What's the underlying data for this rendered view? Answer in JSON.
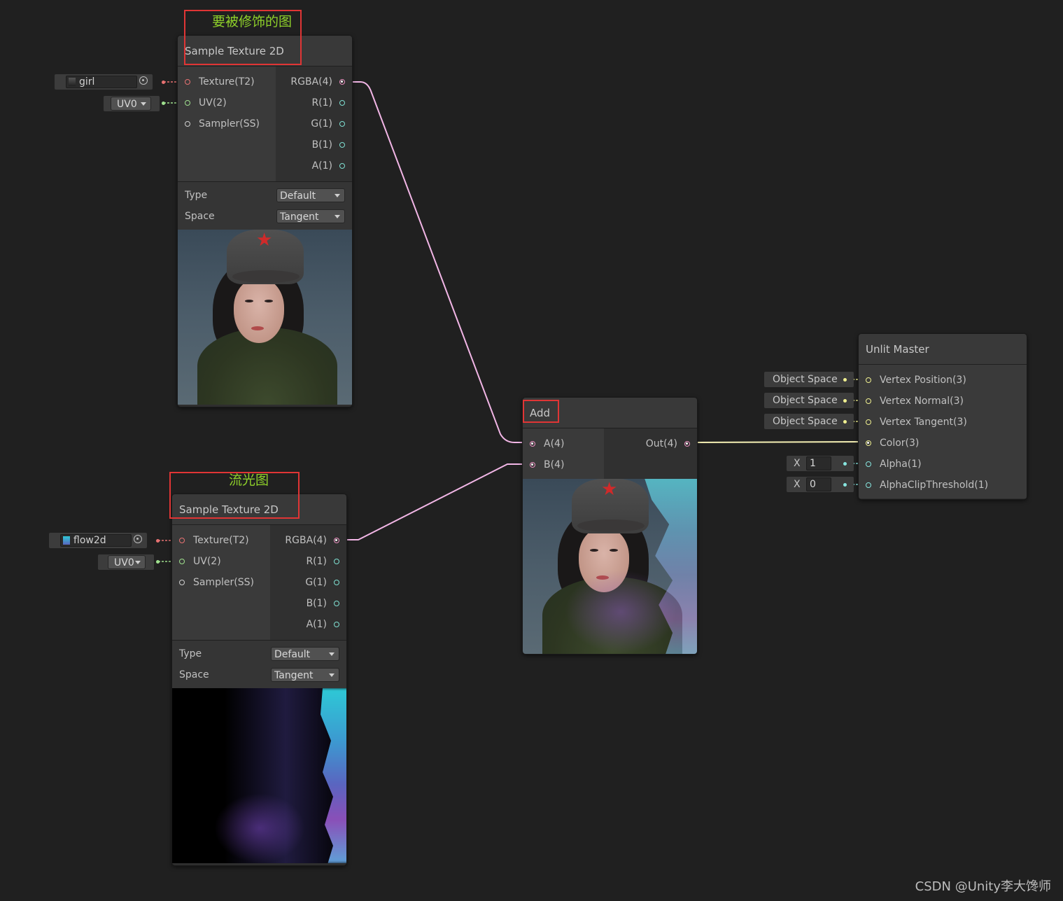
{
  "annotations": {
    "top_label": "要被修饰的图",
    "bottom_label": "流光图"
  },
  "sample_top": {
    "title": "Sample Texture 2D",
    "inputs": [
      "Texture(T2)",
      "UV(2)",
      "Sampler(SS)"
    ],
    "outputs": [
      "RGBA(4)",
      "R(1)",
      "G(1)",
      "B(1)",
      "A(1)"
    ],
    "type_label": "Type",
    "type_value": "Default",
    "space_label": "Space",
    "space_value": "Tangent",
    "texture_prop": "girl",
    "uv_prop": "UV0"
  },
  "sample_bottom": {
    "title": "Sample Texture 2D",
    "inputs": [
      "Texture(T2)",
      "UV(2)",
      "Sampler(SS)"
    ],
    "outputs": [
      "RGBA(4)",
      "R(1)",
      "G(1)",
      "B(1)",
      "A(1)"
    ],
    "type_label": "Type",
    "type_value": "Default",
    "space_label": "Space",
    "space_value": "Tangent",
    "texture_prop": "flow2d",
    "uv_prop": "UV0"
  },
  "add_node": {
    "title": "Add",
    "inputs": [
      "A(4)",
      "B(4)"
    ],
    "output": "Out(4)"
  },
  "master": {
    "title": "Unlit Master",
    "inputs": [
      "Vertex Position(3)",
      "Vertex Normal(3)",
      "Vertex Tangent(3)",
      "Color(3)",
      "Alpha(1)",
      "AlphaClipThreshold(1)"
    ],
    "space_props": [
      "Object Space",
      "Object Space",
      "Object Space"
    ],
    "alpha_label": "X",
    "alpha_value": "1",
    "clip_label": "X",
    "clip_value": "0"
  },
  "colors": {
    "wire_pink": "#f2b6e6",
    "wire_yellow": "#f5f0b4",
    "annotation_red": "#e03535",
    "annotation_text": "#8fd12a"
  },
  "watermark": "CSDN @Unity李大馋师"
}
